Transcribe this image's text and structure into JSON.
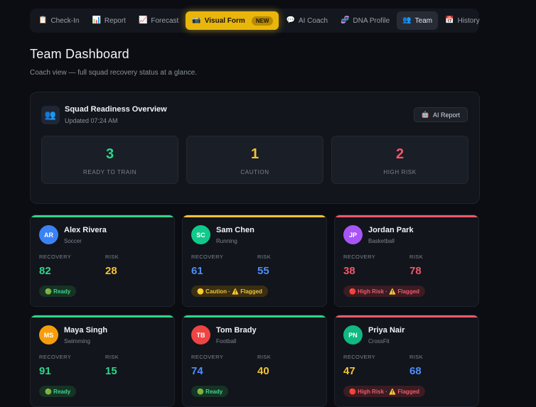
{
  "nav": {
    "tabs": [
      {
        "icon": "📋",
        "label": "Check-In"
      },
      {
        "icon": "📊",
        "label": "Report"
      },
      {
        "icon": "📈",
        "label": "Forecast"
      },
      {
        "icon": "📸",
        "label": "Visual Form",
        "badge": "NEW"
      },
      {
        "icon": "💬",
        "label": "AI Coach"
      },
      {
        "icon": "🧬",
        "label": "DNA Profile"
      },
      {
        "icon": "👥",
        "label": "Team"
      },
      {
        "icon": "📅",
        "label": "History"
      }
    ]
  },
  "page": {
    "title": "Team Dashboard",
    "subtitle": "Coach view — full squad recovery status at a glance."
  },
  "overview": {
    "icon": "👥",
    "title": "Squad Readiness Overview",
    "updated": "Updated 07:24 AM",
    "ai_report_icon": "🤖",
    "ai_report_label": "AI Report",
    "stats": [
      {
        "value": "3",
        "label": "READY TO TRAIN",
        "color": "#2ed58a"
      },
      {
        "value": "1",
        "label": "CAUTION",
        "color": "#f2c235"
      },
      {
        "value": "2",
        "label": "HIGH RISK",
        "color": "#f0586c"
      }
    ]
  },
  "labels": {
    "recovery": "RECOVERY",
    "risk": "RISK"
  },
  "athletes": [
    {
      "initials": "AR",
      "name": "Alex Rivera",
      "sport": "Soccer",
      "recovery": "82",
      "risk": "28",
      "status": "🟢 Ready",
      "avatar_color": "#3b82f6",
      "bar_color": "#2ed58a",
      "recovery_color": "#2ed58a",
      "risk_color": "#f2c235",
      "status_kind": "ready"
    },
    {
      "initials": "SC",
      "name": "Sam Chen",
      "sport": "Running",
      "recovery": "61",
      "risk": "55",
      "status": "🟡 Caution · ⚠️ Flagged",
      "avatar_color": "#10c98a",
      "bar_color": "#f2c235",
      "recovery_color": "#4d8ef7",
      "risk_color": "#4d8ef7",
      "status_kind": "caution"
    },
    {
      "initials": "JP",
      "name": "Jordan Park",
      "sport": "Basketball",
      "recovery": "38",
      "risk": "78",
      "status": "🔴 High Risk · ⚠️ Flagged",
      "avatar_color": "#a855f7",
      "bar_color": "#f0586c",
      "recovery_color": "#f0586c",
      "risk_color": "#f0586c",
      "status_kind": "risk"
    },
    {
      "initials": "MS",
      "name": "Maya Singh",
      "sport": "Swimming",
      "recovery": "91",
      "risk": "15",
      "status": "🟢 Ready",
      "avatar_color": "#f59e0b",
      "bar_color": "#2ed58a",
      "recovery_color": "#2ed58a",
      "risk_color": "#2ed58a",
      "status_kind": "ready"
    },
    {
      "initials": "TB",
      "name": "Tom Brady",
      "sport": "Football",
      "recovery": "74",
      "risk": "40",
      "status": "🟢 Ready",
      "avatar_color": "#ef4444",
      "bar_color": "#2ed58a",
      "recovery_color": "#4d8ef7",
      "risk_color": "#f2c235",
      "status_kind": "ready"
    },
    {
      "initials": "PN",
      "name": "Priya Nair",
      "sport": "CrossFit",
      "recovery": "47",
      "risk": "68",
      "status": "🔴 High Risk · ⚠️ Flagged",
      "avatar_color": "#10b981",
      "bar_color": "#f0586c",
      "recovery_color": "#f2c235",
      "risk_color": "#4d8ef7",
      "status_kind": "risk"
    }
  ]
}
